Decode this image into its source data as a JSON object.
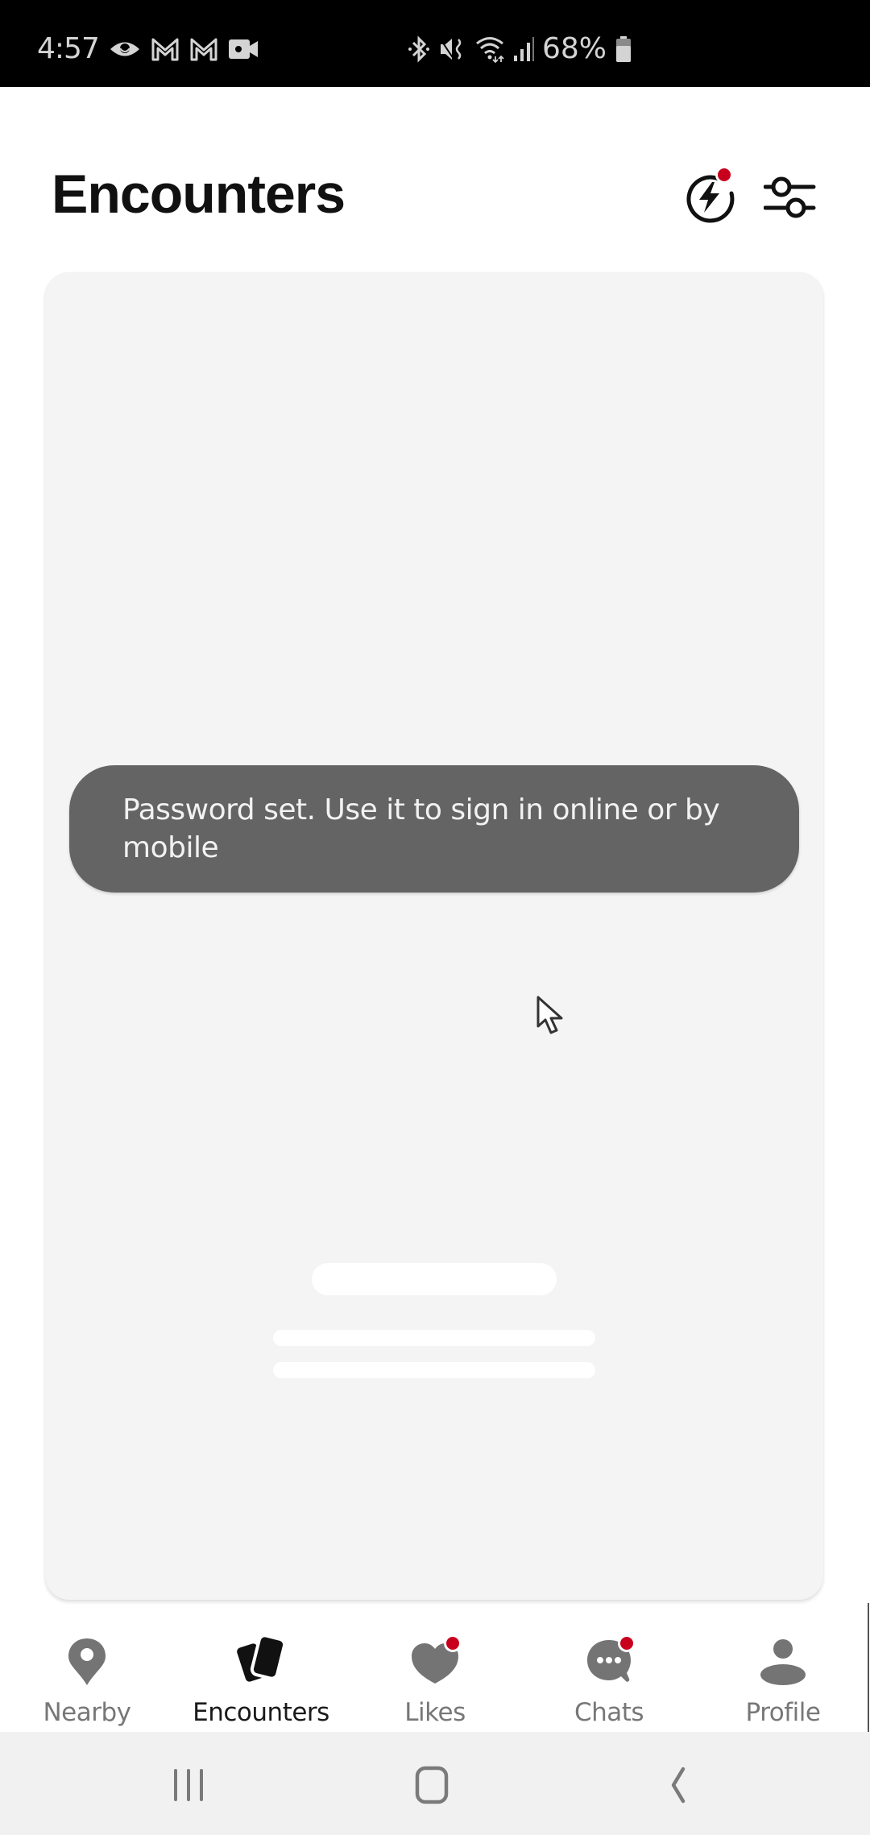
{
  "status_bar": {
    "time": "4:57",
    "left_icons": [
      "eye-icon",
      "gmail-icon",
      "gmail-icon",
      "video-camera-icon"
    ],
    "right_icons": [
      "bluetooth-icon",
      "mute-icon",
      "wifi-icon",
      "signal-icon"
    ],
    "battery_percent": "68%",
    "battery_level": 0.68
  },
  "header": {
    "title": "Encounters",
    "boost_icon": "lightning-circle-icon",
    "boost_has_notification": true,
    "filter_icon": "sliders-icon"
  },
  "card": {
    "loading": true,
    "skeleton_lines": 2
  },
  "toast": {
    "message": "Password set. Use it to sign in online or by mobile"
  },
  "bottom_nav": {
    "active": "encounters",
    "items": [
      {
        "id": "nearby",
        "label": "Nearby",
        "icon": "location-pin-icon",
        "badge": false
      },
      {
        "id": "encounters",
        "label": "Encounters",
        "icon": "cards-icon",
        "badge": false
      },
      {
        "id": "likes",
        "label": "Likes",
        "icon": "heart-icon",
        "badge": true
      },
      {
        "id": "chats",
        "label": "Chats",
        "icon": "chat-bubble-icon",
        "badge": true
      },
      {
        "id": "profile",
        "label": "Profile",
        "icon": "person-icon",
        "badge": false
      }
    ]
  },
  "system_nav": {
    "buttons": [
      "recent-apps",
      "home",
      "back"
    ]
  },
  "colors": {
    "notification_red": "#c8001e",
    "toast_bg": "#646464",
    "card_bg": "#f3f4f3",
    "inactive_icon": "#747474",
    "active_icon": "#111111"
  }
}
